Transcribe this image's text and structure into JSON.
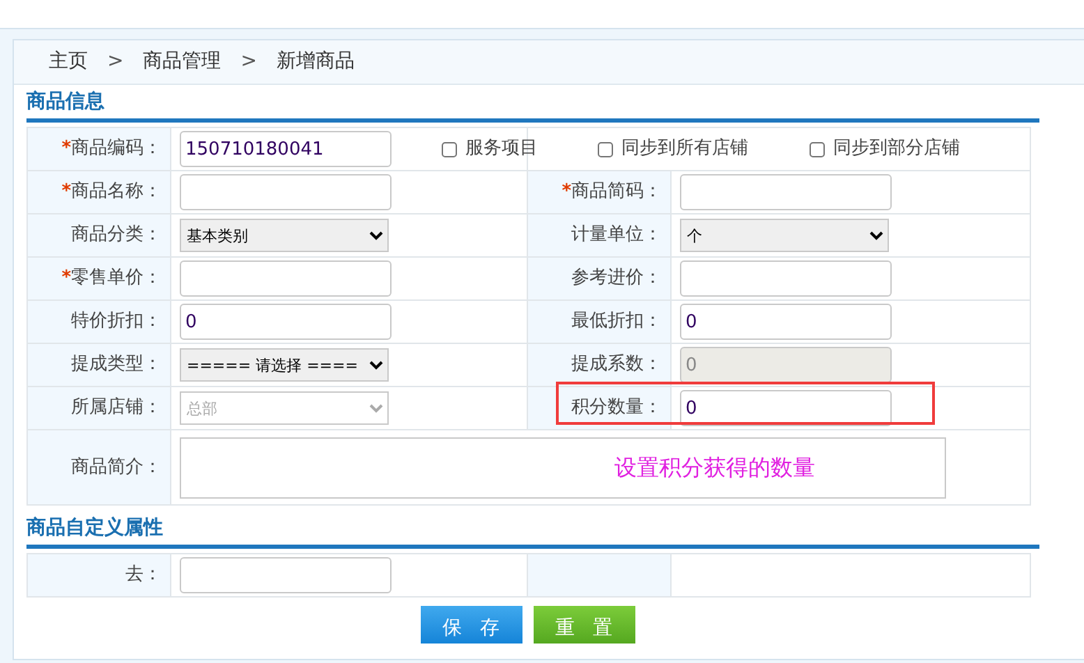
{
  "required_mark": "*",
  "breadcrumb": {
    "separator": ">",
    "items": [
      {
        "label": "主页"
      },
      {
        "label": "商品管理"
      },
      {
        "label": "新增商品"
      }
    ]
  },
  "product_info": {
    "title": "商品信息",
    "code_row": {
      "field": {
        "label": "商品编码：",
        "required": true,
        "kind": "text",
        "value": "150710180041"
      },
      "checkboxes": [
        {
          "label": "服务项目",
          "checked": false
        },
        {
          "label": "同步到所有店铺",
          "checked": false
        },
        {
          "label": "同步到部分店铺",
          "checked": false
        }
      ]
    },
    "rows": [
      [
        {
          "label": "商品名称：",
          "required": true,
          "kind": "text"
        },
        {
          "label": "商品简码：",
          "required": true,
          "kind": "text"
        }
      ],
      [
        {
          "label": "商品分类：",
          "required": false,
          "kind": "select",
          "value": "基本类别"
        },
        {
          "label": "计量单位：",
          "required": false,
          "kind": "select",
          "value": "个"
        }
      ],
      [
        {
          "label": "零售单价：",
          "required": true,
          "kind": "text"
        },
        {
          "label": "参考进价：",
          "required": false,
          "kind": "text"
        }
      ],
      [
        {
          "label": "特价折扣：",
          "required": false,
          "kind": "text",
          "value": "0"
        },
        {
          "label": "最低折扣：",
          "required": false,
          "kind": "text",
          "value": "0"
        }
      ],
      [
        {
          "label": "提成类型：",
          "required": false,
          "kind": "select",
          "value": "===== 请选择 ===="
        },
        {
          "label": "提成系数：",
          "required": false,
          "kind": "disabled_text",
          "value": "0"
        }
      ],
      [
        {
          "label": "所属店铺：",
          "required": false,
          "kind": "disabled_select",
          "value": "总部"
        },
        {
          "label": "积分数量：",
          "required": false,
          "kind": "text",
          "value": "0",
          "highlighted": true
        }
      ]
    ],
    "description": {
      "label": "商品简介：",
      "annotation": "设置积分获得的数量"
    }
  },
  "custom_attributes": {
    "title": "商品自定义属性",
    "fields": [
      {
        "label": "去：",
        "required": false,
        "kind": "text"
      }
    ]
  },
  "buttons": [
    {
      "label": "保 存",
      "kind": "save"
    },
    {
      "label": "重 置",
      "kind": "reset"
    }
  ]
}
